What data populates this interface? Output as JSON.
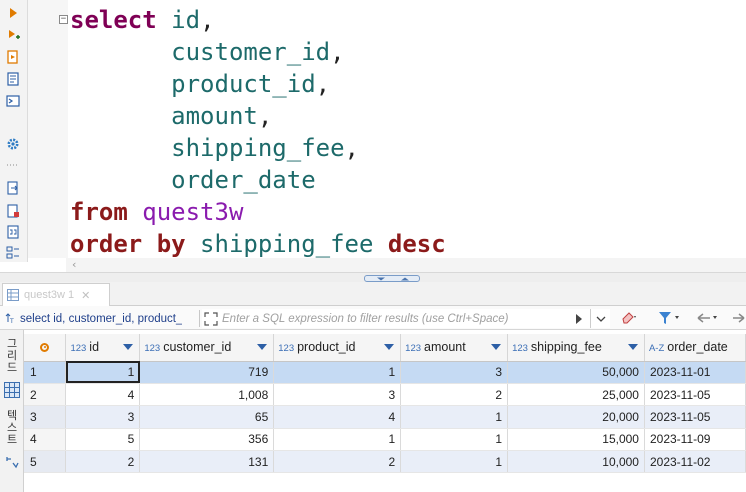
{
  "editor": {
    "fold_marker": "−",
    "lines": [
      [
        {
          "t": "select",
          "c": "kw"
        },
        {
          "t": " ",
          "c": "pun"
        },
        {
          "t": "id",
          "c": "col"
        },
        {
          "t": ",",
          "c": "pun"
        }
      ],
      [
        {
          "t": "       ",
          "c": "pun"
        },
        {
          "t": "customer_id",
          "c": "col"
        },
        {
          "t": ",",
          "c": "pun"
        }
      ],
      [
        {
          "t": "       ",
          "c": "pun"
        },
        {
          "t": "product_id",
          "c": "col"
        },
        {
          "t": ",",
          "c": "pun"
        }
      ],
      [
        {
          "t": "       ",
          "c": "pun"
        },
        {
          "t": "amount",
          "c": "col"
        },
        {
          "t": ",",
          "c": "pun"
        }
      ],
      [
        {
          "t": "       ",
          "c": "pun"
        },
        {
          "t": "shipping_fee",
          "c": "col"
        },
        {
          "t": ",",
          "c": "pun"
        }
      ],
      [
        {
          "t": "       ",
          "c": "pun"
        },
        {
          "t": "order_date",
          "c": "col"
        }
      ],
      [
        {
          "t": "from",
          "c": "kw2"
        },
        {
          "t": " ",
          "c": "pun"
        },
        {
          "t": "quest3w",
          "c": "tbl"
        }
      ],
      [
        {
          "t": "order by",
          "c": "kw2"
        },
        {
          "t": " ",
          "c": "pun"
        },
        {
          "t": "shipping_fee",
          "c": "col"
        },
        {
          "t": " ",
          "c": "pun"
        },
        {
          "t": "desc",
          "c": "kw2"
        }
      ]
    ]
  },
  "scroll": {
    "left_arrow": "‹"
  },
  "results_tab": {
    "label": "quest3w 1",
    "close": "✕"
  },
  "filter_bar": {
    "query_text": "select id, customer_id, product_",
    "placeholder": "Enter a SQL expression to filter results (use Ctrl+Space)"
  },
  "side_panel": {
    "grid_tab": [
      "그",
      "리",
      "드"
    ],
    "text_tab": [
      "텍",
      "스",
      "트"
    ]
  },
  "grid": {
    "columns": [
      {
        "type": "123",
        "label": "id"
      },
      {
        "type": "123",
        "label": "customer_id"
      },
      {
        "type": "123",
        "label": "product_id"
      },
      {
        "type": "123",
        "label": "amount"
      },
      {
        "type": "123",
        "label": "shipping_fee"
      },
      {
        "type": "A-Z",
        "label": "order_date"
      }
    ],
    "rows": [
      [
        "1",
        "1",
        "719",
        "1",
        "3",
        "50,000",
        "2023-11-01"
      ],
      [
        "2",
        "4",
        "1,008",
        "3",
        "2",
        "25,000",
        "2023-11-05"
      ],
      [
        "3",
        "3",
        "65",
        "4",
        "1",
        "20,000",
        "2023-11-05"
      ],
      [
        "4",
        "5",
        "356",
        "1",
        "1",
        "15,000",
        "2023-11-09"
      ],
      [
        "5",
        "2",
        "131",
        "2",
        "1",
        "10,000",
        "2023-11-02"
      ]
    ],
    "selected_row": 0
  },
  "colors": {
    "keyword": "#7f0055",
    "identifier": "#1d6a6a",
    "table_name": "#8a1bae",
    "selection": "#c5daf3",
    "stripe": "#e9eef8"
  }
}
